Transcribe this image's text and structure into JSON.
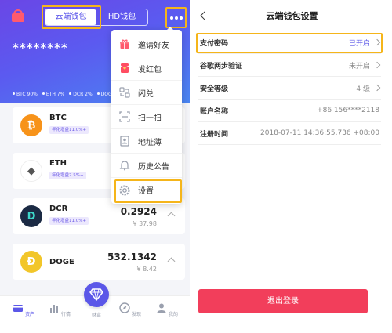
{
  "left": {
    "segments": [
      "云端钱包",
      "HD钱包"
    ],
    "balance": "********",
    "allocation": [
      "BTC 90%",
      "ETH 7%",
      "DCR 2%",
      "DOGE 1%"
    ],
    "coins": [
      {
        "name": "BTC",
        "rate": "年化增益11.0%+",
        "amount": "",
        "fiat": "",
        "color": "#f7931a",
        "symbol": "₿"
      },
      {
        "name": "ETH",
        "rate": "年化增益2.5%+",
        "amount": "",
        "fiat": "",
        "color": "#ffffff",
        "symbol": "◆"
      },
      {
        "name": "DCR",
        "rate": "年化增益11.0%+",
        "amount": "0.2924",
        "fiat": "¥ 37.98",
        "color": "#1b2a44",
        "symbol": "D"
      },
      {
        "name": "DOGE",
        "rate": "",
        "amount": "532.1342",
        "fiat": "¥ 8.42",
        "color": "#f2c62a",
        "symbol": "Ð"
      }
    ],
    "menu": [
      {
        "label": "邀请好友",
        "icon": "gift-icon"
      },
      {
        "label": "发红包",
        "icon": "red-envelope-icon"
      },
      {
        "label": "闪兑",
        "icon": "exchange-icon"
      },
      {
        "label": "扫一扫",
        "icon": "scan-icon"
      },
      {
        "label": "地址薄",
        "icon": "address-book-icon"
      },
      {
        "label": "历史公告",
        "icon": "bell-icon"
      },
      {
        "label": "设置",
        "icon": "settings-icon"
      }
    ],
    "tabs": [
      {
        "label": "资产",
        "icon": "wallet-icon",
        "active": true
      },
      {
        "label": "行情",
        "icon": "chart-icon",
        "active": false
      },
      {
        "label": "财富",
        "icon": "diamond-icon",
        "active": false
      },
      {
        "label": "发现",
        "icon": "compass-icon",
        "active": false
      },
      {
        "label": "我的",
        "icon": "profile-icon",
        "active": false
      }
    ]
  },
  "right": {
    "title": "云端钱包设置",
    "rows": [
      {
        "label": "支付密码",
        "value": "已开启",
        "chevron": true,
        "accent": true
      },
      {
        "label": "谷歌两步验证",
        "value": "未开启",
        "chevron": true,
        "accent": false
      },
      {
        "label": "安全等级",
        "value": "4 级",
        "chevron": true,
        "accent": false
      },
      {
        "label": "账户名称",
        "value": "+86 156****2118",
        "chevron": false,
        "accent": false
      },
      {
        "label": "注册时间",
        "value": "2018-07-11 14:36:55.736 +08:00",
        "chevron": false,
        "accent": false
      }
    ],
    "logout": "退出登录"
  },
  "colors": {
    "accent": "#5b57e8",
    "highlight": "#f5b51a",
    "danger": "#f23e5b"
  }
}
